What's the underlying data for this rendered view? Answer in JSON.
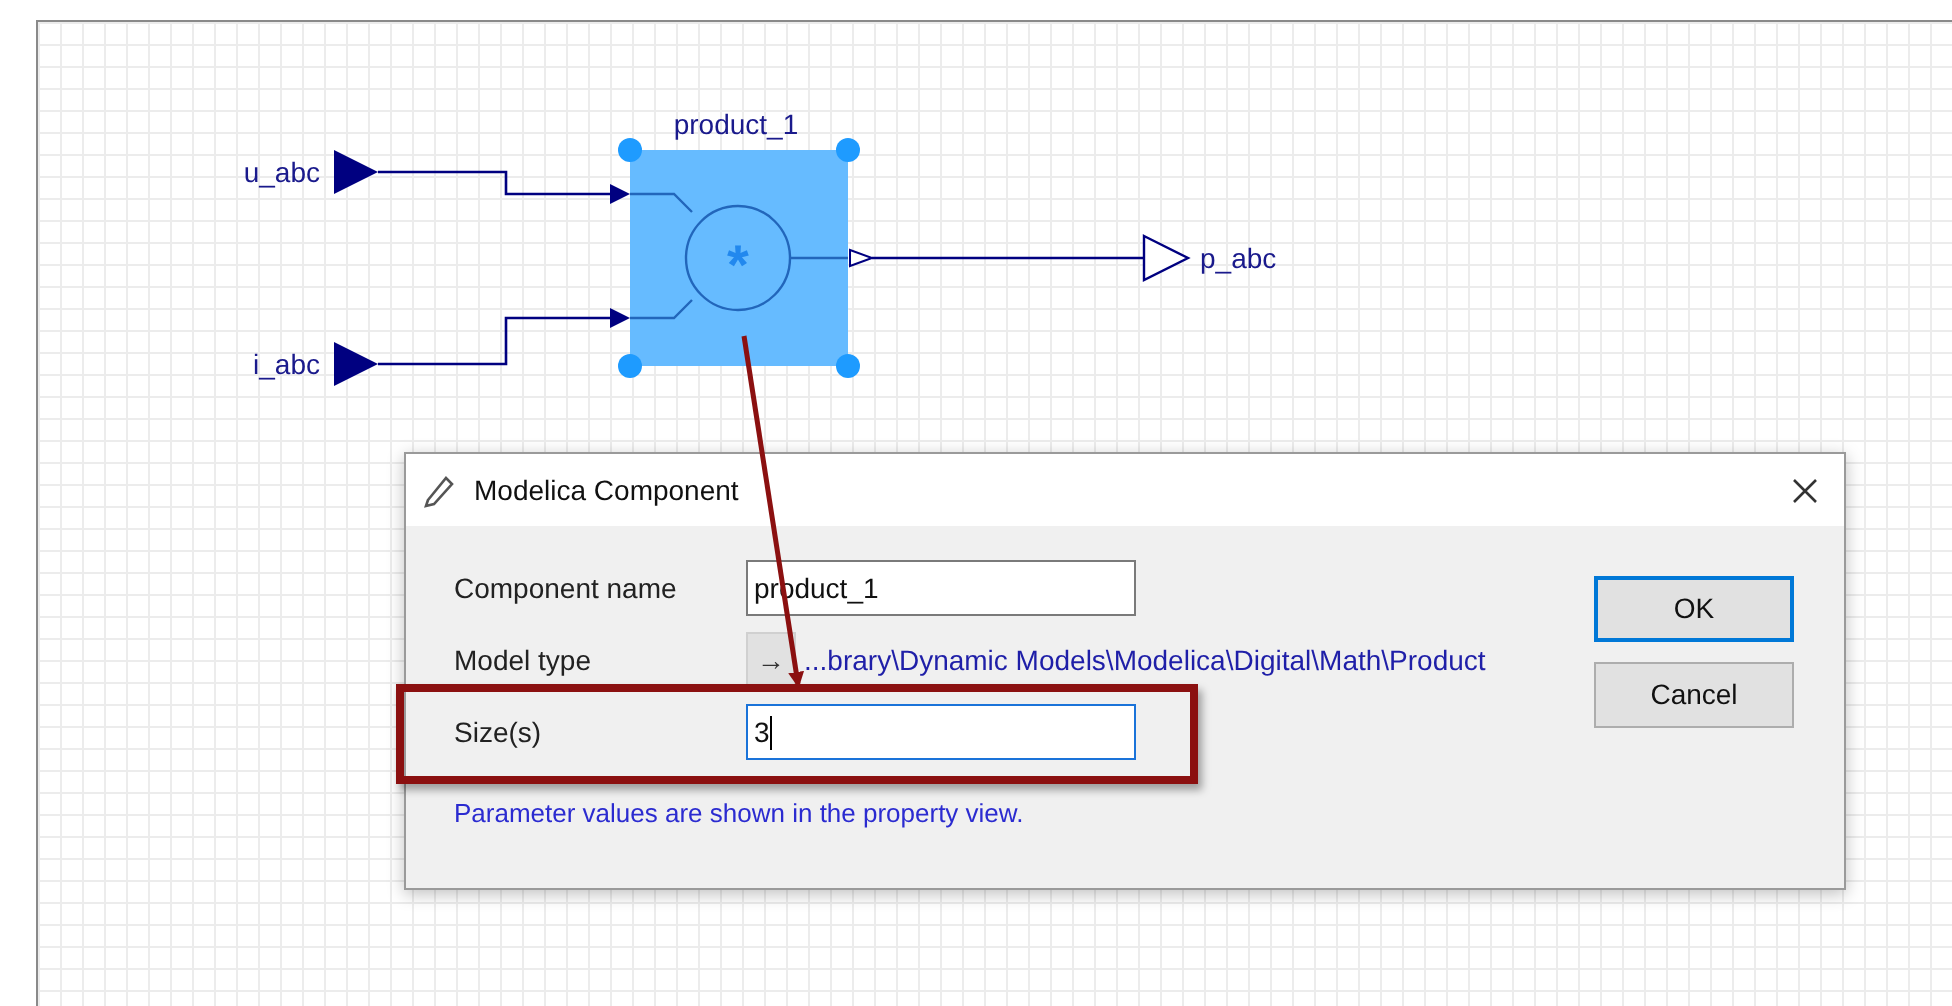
{
  "diagram": {
    "block": {
      "label": "product_1",
      "symbol": "*",
      "selected": true
    },
    "inputs": [
      {
        "label": "u_abc"
      },
      {
        "label": "i_abc"
      }
    ],
    "output": {
      "label": "p_abc"
    }
  },
  "dialog": {
    "title": "Modelica Component",
    "fields": [
      {
        "kind": "text",
        "label": "Component name",
        "value": "product_1",
        "focused": false,
        "highlighted": false
      },
      {
        "kind": "path",
        "label": "Model type",
        "button": "→",
        "value": "...brary\\Dynamic Models\\Modelica\\Digital\\Math\\Product",
        "highlighted": false
      },
      {
        "kind": "text",
        "label": "Size(s)",
        "value": "3",
        "focused": true,
        "highlighted": true
      }
    ],
    "note": "Parameter values are shown in the property view.",
    "buttons": [
      {
        "label": "OK",
        "default": true
      },
      {
        "label": "Cancel",
        "default": false
      }
    ]
  }
}
